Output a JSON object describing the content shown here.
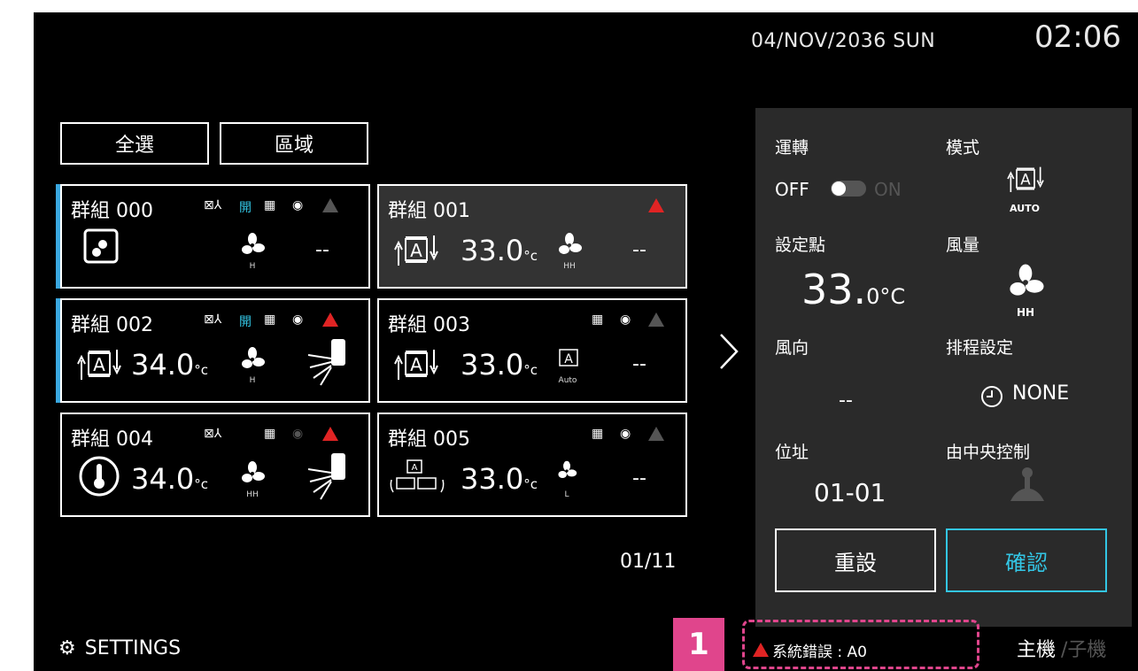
{
  "header": {
    "date": "04/NOV/2036 SUN",
    "time": "02:06"
  },
  "toolbar": {
    "select_all": "全選",
    "zone": "區域"
  },
  "groups": [
    {
      "name": "群組 000",
      "indicator": "開",
      "temp": "",
      "unit": "",
      "fan": "H",
      "right": "--"
    },
    {
      "name": "群組 001",
      "temp": "33.0",
      "unit": "°c",
      "fan": "HH",
      "right": "--"
    },
    {
      "name": "群組 002",
      "indicator": "開",
      "temp": "34.0",
      "unit": "°c",
      "fan": "H"
    },
    {
      "name": "群組 003",
      "temp": "33.0",
      "unit": "°c",
      "fan": "Auto",
      "right": "--"
    },
    {
      "name": "群組 004",
      "temp": "34.0",
      "unit": "°c",
      "fan": "HH"
    },
    {
      "name": "群組 005",
      "temp": "33.0",
      "unit": "°c",
      "fan": "L",
      "right": "--"
    }
  ],
  "pager": "01/11",
  "panel": {
    "run_label": "運轉",
    "mode_label": "模式",
    "off": "OFF",
    "on": "ON",
    "mode_value": "AUTO",
    "setpoint_label": "設定點",
    "fan_label": "風量",
    "setpoint_value": "33.",
    "setpoint_unit": "0°C",
    "fan_value": "HH",
    "direction_label": "風向",
    "schedule_label": "排程設定",
    "direction_value": "--",
    "schedule_value": "NONE",
    "address_label": "位址",
    "central_label": "由中央控制",
    "address_value": "01-01",
    "reset": "重設",
    "confirm": "確認"
  },
  "footer": {
    "settings": "SETTINGS",
    "callout": "1",
    "error": "系統錯誤 : A0",
    "host": "主機",
    "sub": "/子機"
  },
  "colors": {
    "accent": "#33c6e5",
    "alert": "#e02424",
    "callout": "#e0458c",
    "panel": "#2a2a2a"
  }
}
